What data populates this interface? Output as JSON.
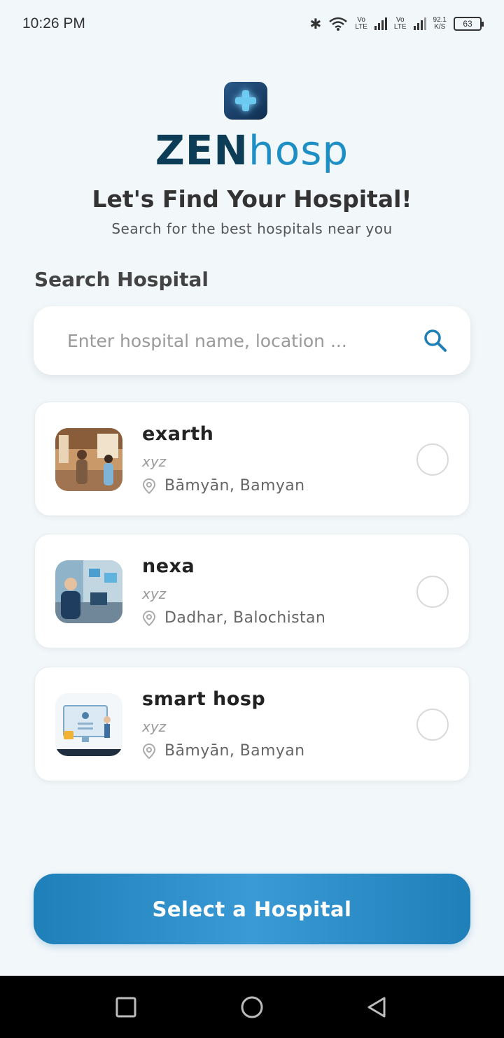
{
  "status_bar": {
    "time": "10:26 PM",
    "vo_lte_1": "Vo\nLTE",
    "vo_lte_2": "Vo\nLTE",
    "speed_value": "92.1",
    "speed_unit": "K/S",
    "battery": "63",
    "icons": [
      "bluetooth-icon",
      "wifi-icon",
      "signal-icon",
      "signal-icon"
    ]
  },
  "brand": {
    "logo_part1": "ZEN",
    "logo_part2": "hosp",
    "colors": {
      "dark": "#0d3d56",
      "accent": "#1e8fc4"
    }
  },
  "headline": "Let's Find Your Hospital!",
  "subheadline": "Search for the best hospitals near you",
  "search": {
    "label": "Search Hospital",
    "placeholder": "Enter hospital name, location ...",
    "value": "",
    "icon": "search-icon"
  },
  "hospitals": [
    {
      "name": "exarth",
      "type": "xyz",
      "location": "Bāmyān, Bamyan",
      "selected": false
    },
    {
      "name": "nexa",
      "type": "xyz",
      "location": "Dadhar, Balochistan",
      "selected": false
    },
    {
      "name": "smart hosp",
      "type": "xyz",
      "location": "Bāmyān, Bamyan",
      "selected": false
    }
  ],
  "action_button": {
    "label": "Select a Hospital",
    "color": "#2a8cc9"
  },
  "nav": {
    "icons": [
      "recent-apps-icon",
      "home-icon",
      "back-icon"
    ]
  }
}
